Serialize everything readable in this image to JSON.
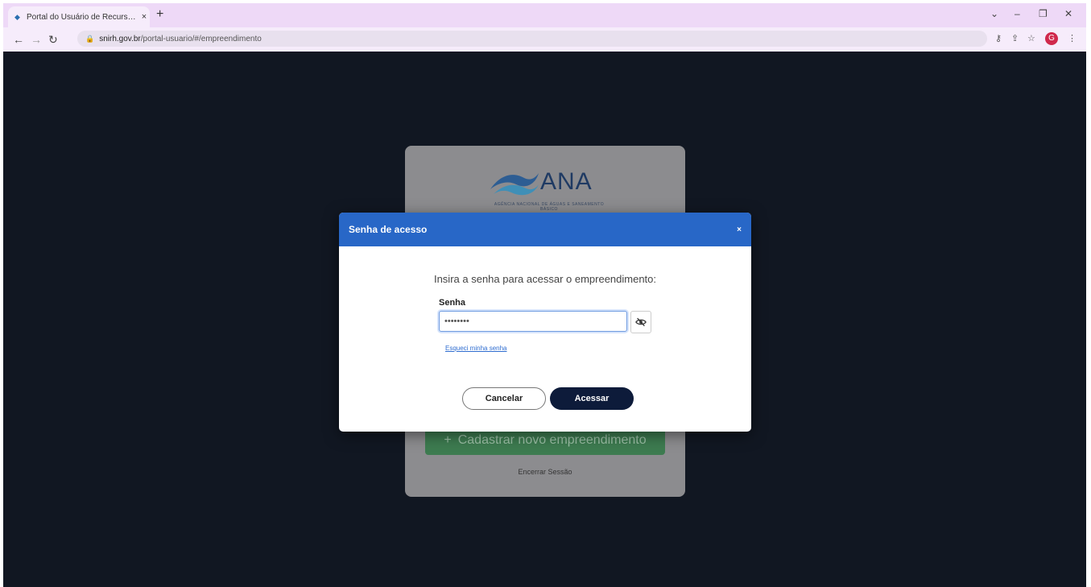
{
  "browser": {
    "tab_title": "Portal do Usuário de Recursos H...",
    "tab_close": "×",
    "new_tab": "+",
    "url_domain": "snirh.gov.br",
    "url_path": "/portal-usuario/#/empreendimento",
    "profile_initial": "G",
    "icons": [
      "back-icon",
      "forward-icon",
      "reload-icon",
      "lock-icon",
      "key-icon",
      "share-icon",
      "star-icon",
      "menu-icon"
    ]
  },
  "card": {
    "logo_text": "ANA",
    "logo_subtitle": "AGÊNCIA NACIONAL DE ÁGUAS E SANEAMENTO BÁSICO",
    "register_button": "Cadastrar novo empreendimento",
    "logout_link": "Encerrar Sessão"
  },
  "modal": {
    "title": "Senha de acesso",
    "close_label": "×",
    "prompt": "Insira a senha para acessar o empreendimento:",
    "field_label": "Senha",
    "password_value": "••••••••",
    "forgot_link": "Esqueci minha senha",
    "cancel_label": "Cancelar",
    "submit_label": "Acessar"
  },
  "colors": {
    "backdrop": "#111722",
    "modal_header": "#2867c7",
    "submit_button": "#0d1b3a",
    "link": "#2f6dd0",
    "register_button": "#3d7b50"
  }
}
